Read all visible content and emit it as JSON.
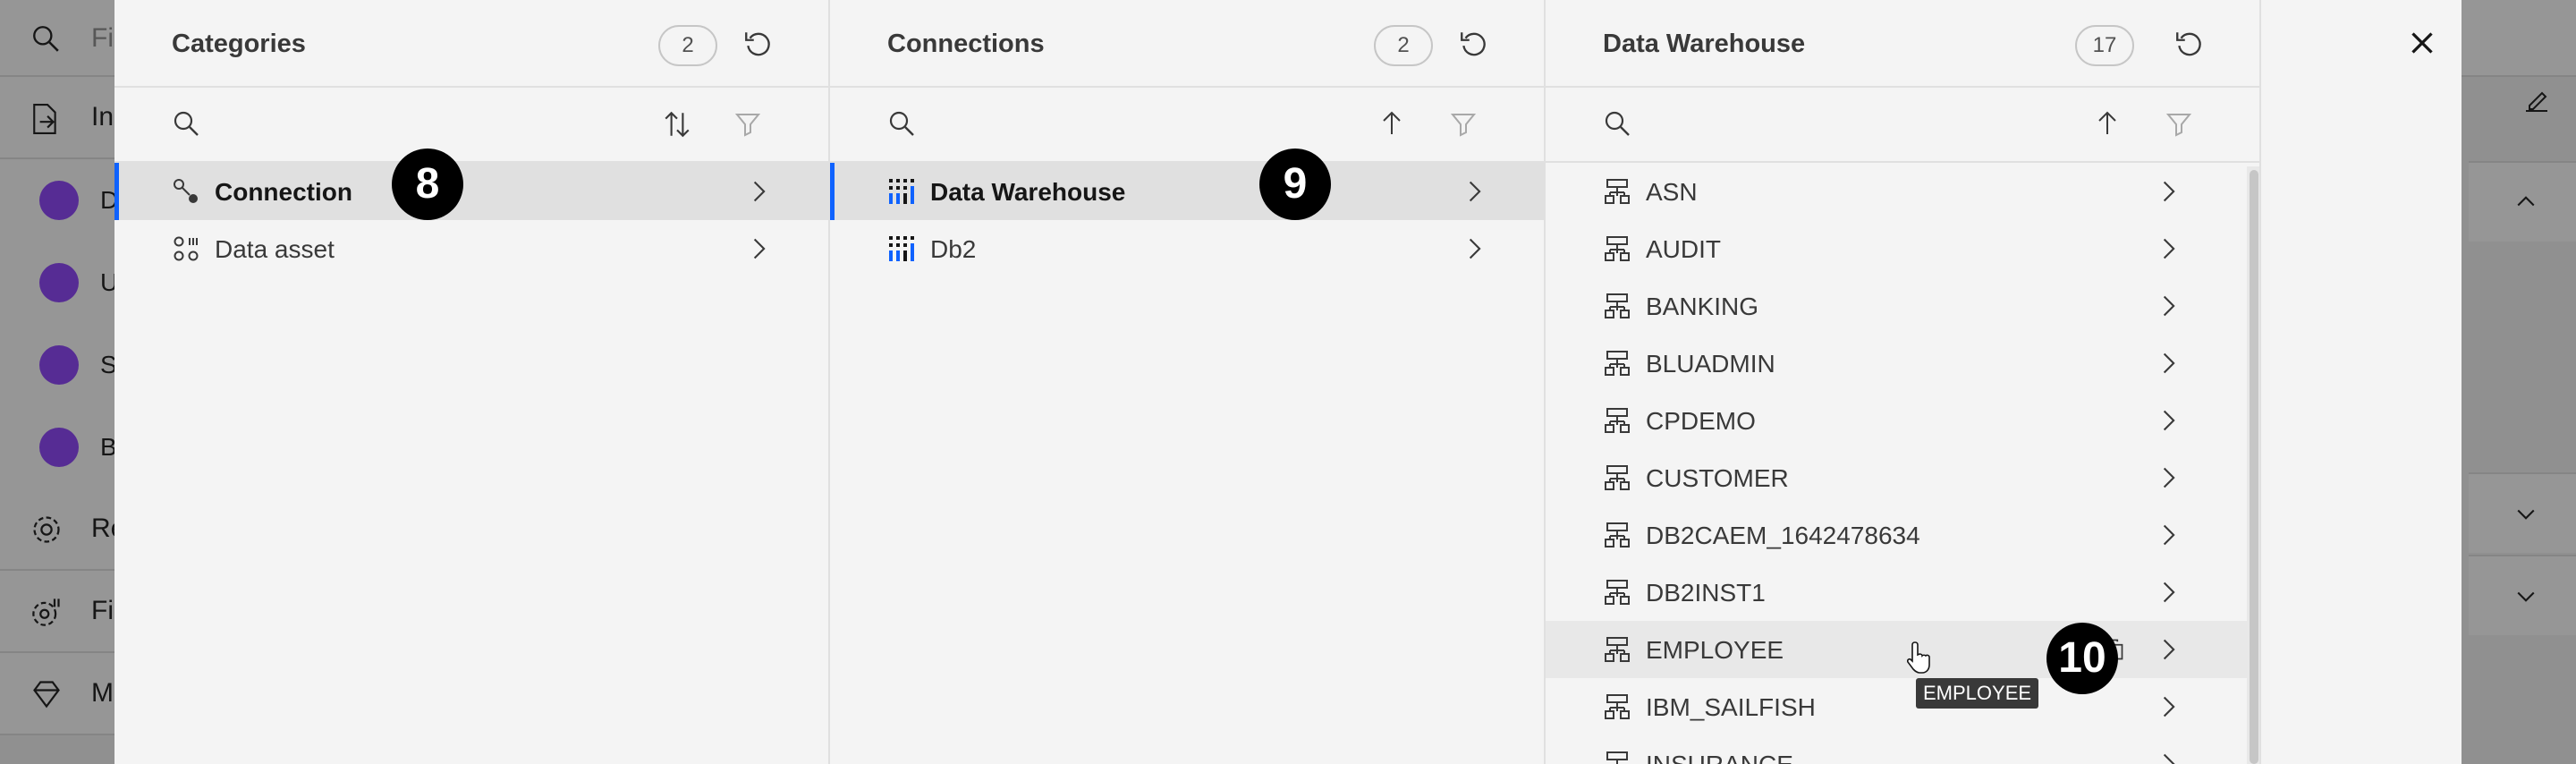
{
  "background": {
    "filter_text": "Fi",
    "nav": [
      {
        "label": "In",
        "icon": "export-icon"
      },
      {
        "label": "Re",
        "icon": "settings-icon"
      },
      {
        "label": "Fi",
        "icon": "settings-adjust-icon"
      },
      {
        "label": "M",
        "icon": "diamond-icon"
      }
    ],
    "sub_items": [
      {
        "label": "D"
      },
      {
        "label": "U"
      },
      {
        "label": "S"
      },
      {
        "label": "B"
      }
    ]
  },
  "categories": {
    "title": "Categories",
    "count": "2",
    "items": [
      {
        "label": "Connection",
        "selected": true,
        "icon": "connection-icon"
      },
      {
        "label": "Data asset",
        "selected": false,
        "icon": "data-asset-icon"
      }
    ]
  },
  "connections": {
    "title": "Connections",
    "count": "2",
    "items": [
      {
        "label": "Data Warehouse",
        "selected": true,
        "icon": "db2-warehouse-icon"
      },
      {
        "label": "Db2",
        "selected": false,
        "icon": "db2-icon"
      }
    ]
  },
  "warehouse": {
    "title": "Data Warehouse",
    "count": "17",
    "items": [
      {
        "label": "ASN"
      },
      {
        "label": "AUDIT"
      },
      {
        "label": "BANKING"
      },
      {
        "label": "BLUADMIN"
      },
      {
        "label": "CPDEMO"
      },
      {
        "label": "CUSTOMER"
      },
      {
        "label": "DB2CAEM_1642478634"
      },
      {
        "label": "DB2INST1"
      },
      {
        "label": "EMPLOYEE"
      },
      {
        "label": "IBM_SAILFISH"
      },
      {
        "label": "INSURANCE"
      }
    ]
  },
  "tooltip": "EMPLOYEE",
  "badges": {
    "b8": "8",
    "b9": "9",
    "b10": "10"
  },
  "colors": {
    "accent": "#0f62fe",
    "selected_row": "#e0e0e0",
    "avatar": "#8a3ffc"
  }
}
